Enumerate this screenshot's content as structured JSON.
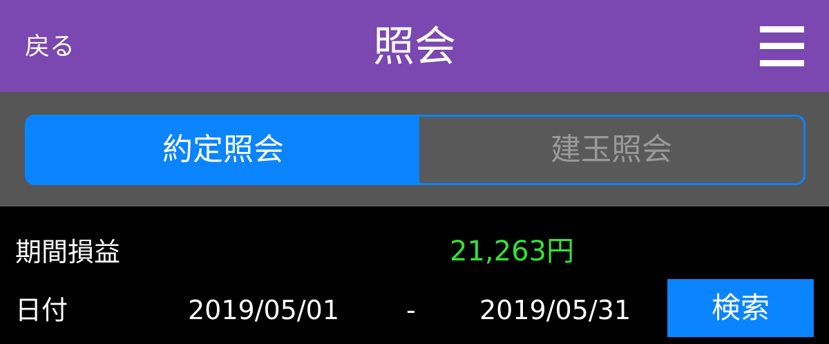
{
  "header": {
    "back_label": "戻る",
    "title": "照会",
    "menu_icon": "hamburger-menu-icon",
    "background_color": "#7B47B0"
  },
  "tabs": {
    "items": [
      {
        "label": "約定照会",
        "active": true
      },
      {
        "label": "建玉照会",
        "active": false
      }
    ],
    "active_color": "#0A84FF"
  },
  "summary": {
    "profit_loss_label": "期間損益",
    "profit_loss_value": "21,263円",
    "profit_loss_color": "#33E533"
  },
  "date_range": {
    "label": "日付",
    "from": "2019/05/01",
    "separator": "-",
    "to": "2019/05/31"
  },
  "search": {
    "button_label": "検索"
  }
}
